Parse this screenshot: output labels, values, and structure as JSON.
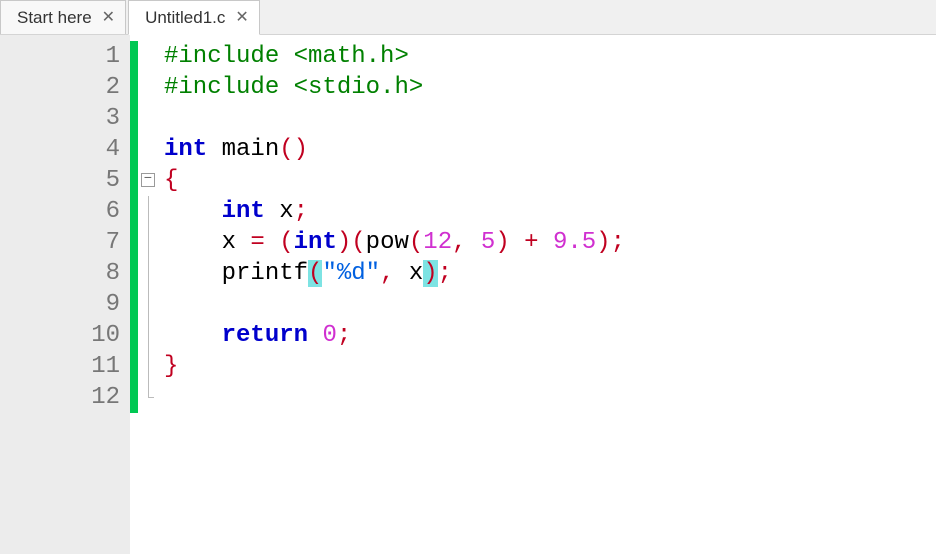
{
  "tabs": [
    {
      "title": "Start here",
      "active": false
    },
    {
      "title": "Untitled1.c",
      "active": true
    }
  ],
  "close_glyph": "✕",
  "fold_glyph": "−",
  "lines": [
    {
      "n": "1",
      "chg": true,
      "fold": "",
      "seg": [
        [
          "pre",
          "#include <math.h>"
        ]
      ]
    },
    {
      "n": "2",
      "chg": true,
      "fold": "",
      "seg": [
        [
          "pre",
          "#include <stdio.h>"
        ]
      ]
    },
    {
      "n": "3",
      "chg": true,
      "fold": "",
      "seg": [
        [
          "",
          ""
        ]
      ]
    },
    {
      "n": "4",
      "chg": true,
      "fold": "",
      "seg": [
        [
          "kw",
          "int"
        ],
        [
          "",
          " "
        ],
        [
          "fn",
          "main"
        ],
        [
          "punc",
          "()"
        ]
      ]
    },
    {
      "n": "5",
      "chg": true,
      "fold": "box",
      "seg": [
        [
          "punc",
          "{"
        ]
      ]
    },
    {
      "n": "6",
      "chg": true,
      "fold": "line",
      "seg": [
        [
          "",
          "    "
        ],
        [
          "kw",
          "int"
        ],
        [
          "",
          " "
        ],
        [
          "id",
          "x"
        ],
        [
          "punc",
          ";"
        ]
      ]
    },
    {
      "n": "7",
      "chg": true,
      "fold": "line",
      "seg": [
        [
          "",
          "    "
        ],
        [
          "id",
          "x "
        ],
        [
          "op",
          "="
        ],
        [
          "",
          " "
        ],
        [
          "punc",
          "("
        ],
        [
          "kw",
          "int"
        ],
        [
          "punc",
          ")"
        ],
        [
          "punc",
          "("
        ],
        [
          "id",
          "pow"
        ],
        [
          "punc",
          "("
        ],
        [
          "num",
          "12"
        ],
        [
          "punc",
          ","
        ],
        [
          "",
          " "
        ],
        [
          "num",
          "5"
        ],
        [
          "punc",
          ")"
        ],
        [
          "",
          " "
        ],
        [
          "op",
          "+"
        ],
        [
          "",
          " "
        ],
        [
          "num",
          "9.5"
        ],
        [
          "punc",
          ")"
        ],
        [
          "punc",
          ";"
        ]
      ]
    },
    {
      "n": "8",
      "chg": true,
      "fold": "line",
      "seg": [
        [
          "",
          "    "
        ],
        [
          "id",
          "printf"
        ],
        [
          "punc hl",
          "("
        ],
        [
          "str",
          "\"%d\""
        ],
        [
          "punc",
          ","
        ],
        [
          "",
          " "
        ],
        [
          "id",
          "x"
        ],
        [
          "punc hl",
          ")"
        ],
        [
          "punc",
          ";"
        ]
      ]
    },
    {
      "n": "9",
      "chg": true,
      "fold": "line",
      "seg": [
        [
          "",
          ""
        ]
      ]
    },
    {
      "n": "10",
      "chg": true,
      "fold": "line",
      "seg": [
        [
          "",
          "    "
        ],
        [
          "kw",
          "return"
        ],
        [
          "",
          " "
        ],
        [
          "num",
          "0"
        ],
        [
          "punc",
          ";"
        ]
      ]
    },
    {
      "n": "11",
      "chg": true,
      "fold": "line",
      "seg": [
        [
          "punc",
          "}"
        ]
      ]
    },
    {
      "n": "12",
      "chg": true,
      "fold": "end",
      "seg": [
        [
          "",
          ""
        ]
      ]
    }
  ]
}
